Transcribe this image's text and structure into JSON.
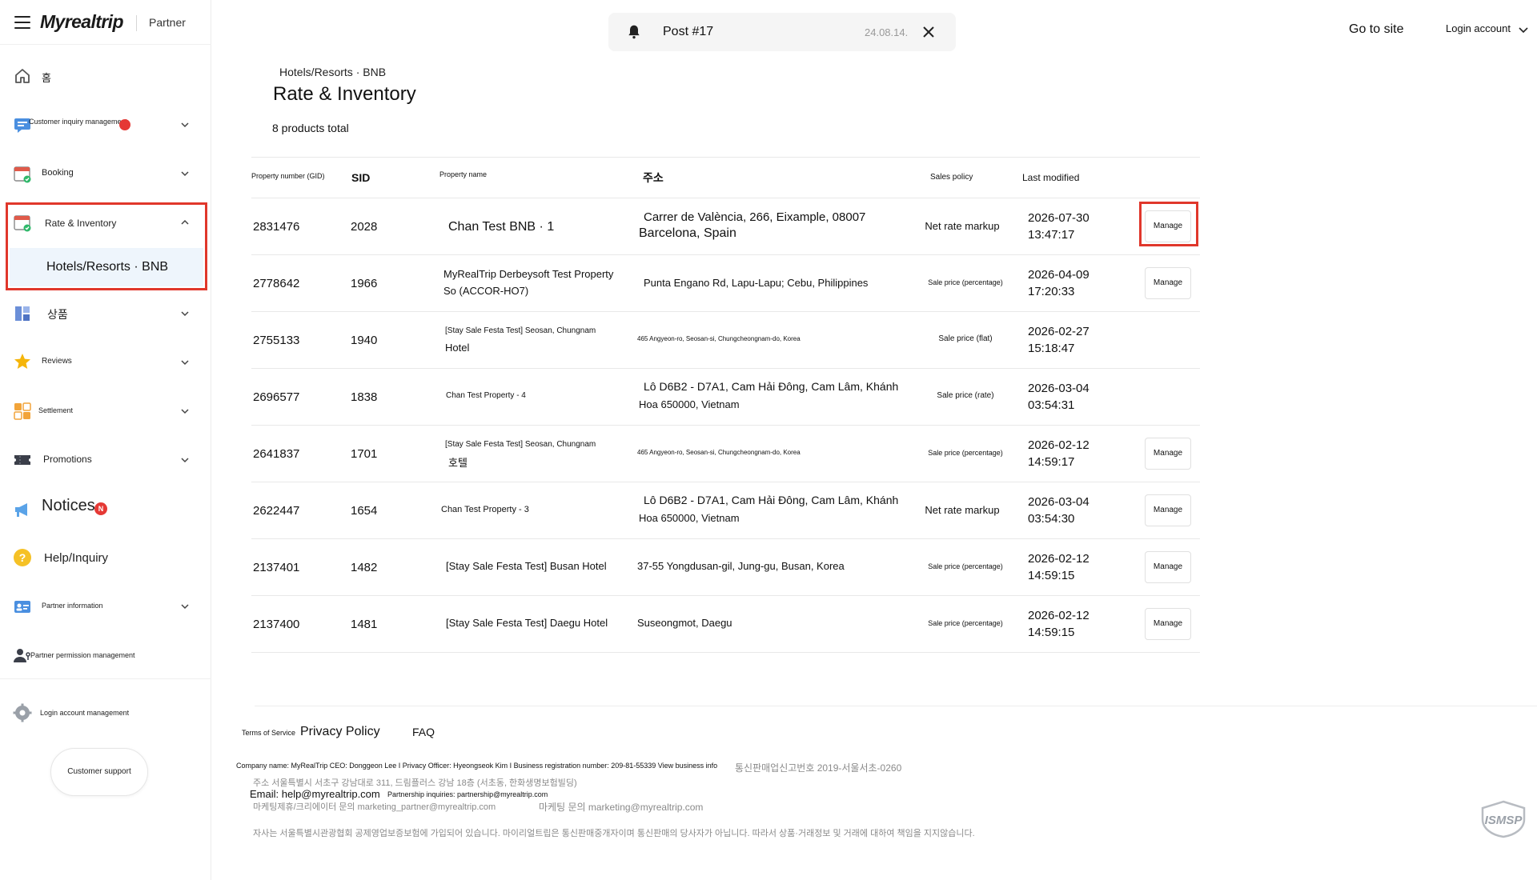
{
  "brand": {
    "logo_text": "Myrealtrip",
    "partner_label": "Partner"
  },
  "sidebar": {
    "home": "홈",
    "customer_inquiry": "Customer inquiry management",
    "booking": "Booking",
    "rate_inventory": "Rate & Inventory",
    "hotels_sub": "Hotels/Resorts · BNB",
    "products": "상품",
    "reviews": "Reviews",
    "settlement": "Settlement",
    "promotions": "Promotions",
    "notices": "Notices",
    "notices_badge": "N",
    "help": "Help/Inquiry",
    "partner_info": "Partner information",
    "permission": "Partner permission management",
    "login_mgmt": "Login account management",
    "customer_support": "Customer support"
  },
  "topbar": {
    "notice_title": "Post #17",
    "notice_date": "24.08.14.",
    "go_to_site": "Go to site",
    "login_account": "Login account"
  },
  "main": {
    "breadcrumb": "Hotels/Resorts · BNB",
    "title": "Rate & Inventory",
    "total": "8 products total"
  },
  "table": {
    "headers": {
      "property_number": "Property number (GID)",
      "sid": "SID",
      "property_name": "Property name",
      "address": "주소",
      "sales_policy": "Sales policy",
      "last_modified": "Last modified"
    },
    "manage_label": "Manage",
    "rows": [
      {
        "gid": "2831476",
        "sid": "2028",
        "name": "Chan Test BNB  · 1",
        "address_l1": "Carrer de València, 266, Eixample, 08007",
        "address_l2": "Barcelona, Spain",
        "policy": "Net rate markup",
        "date": "2026-07-30",
        "time": "13:47:17",
        "manage": true
      },
      {
        "gid": "2778642",
        "sid": "1966",
        "name": "MyRealTrip Derbeysoft Test Property So (ACCOR-HO7)",
        "address_l1": "Punta Engano Rd, Lapu-Lapu; Cebu, Philippines",
        "address_l2": "",
        "policy": "Sale price (percentage)",
        "date": "2026-04-09",
        "time": "17:20:33",
        "manage": true
      },
      {
        "gid": "2755133",
        "sid": "1940",
        "name_l1": "[Stay Sale Festa Test] Seosan, Chungnam",
        "name_l2": "Hotel",
        "address_l1": "465 Angyeon-ro, Seosan-si, Chungcheongnam-do, Korea",
        "address_l2": "",
        "policy": "Sale price (flat)",
        "date": "2026-02-27",
        "time": "15:18:47",
        "manage": false
      },
      {
        "gid": "2696577",
        "sid": "1838",
        "name": "Chan Test Property - 4",
        "address_l1": "Lô D6B2 - D7A1, Cam Hải Đông, Cam Lâm, Khánh",
        "address_l2": "Hoa 650000, Vietnam",
        "policy": "Sale price (rate)",
        "date": "2026-03-04",
        "time": "03:54:31",
        "manage": false
      },
      {
        "gid": "2641837",
        "sid": "1701",
        "name_l1": "[Stay Sale Festa Test] Seosan, Chungnam",
        "name_l2": "호텔",
        "address_l1": "465 Angyeon-ro, Seosan-si, Chungcheongnam-do, Korea",
        "address_l2": "",
        "policy": "Sale price (percentage)",
        "date": "2026-02-12",
        "time": "14:59:17",
        "manage": true
      },
      {
        "gid": "2622447",
        "sid": "1654",
        "name": "Chan Test Property - 3",
        "address_l1": "Lô D6B2 - D7A1, Cam Hải Đông, Cam Lâm, Khánh",
        "address_l2": "Hoa 650000, Vietnam",
        "policy": "Net rate markup",
        "date": "2026-03-04",
        "time": "03:54:30",
        "manage": true
      },
      {
        "gid": "2137401",
        "sid": "1482",
        "name": "[Stay Sale Festa Test] Busan Hotel",
        "address_l1": "37-55 Yongdusan-gil, Jung-gu, Busan, Korea",
        "address_l2": "",
        "policy": "Sale price (percentage)",
        "date": "2026-02-12",
        "time": "14:59:15",
        "manage": true
      },
      {
        "gid": "2137400",
        "sid": "1481",
        "name": "[Stay Sale Festa Test] Daegu Hotel",
        "address_l1": "Suseongmot, Daegu",
        "address_l2": "",
        "policy": "Sale price (percentage)",
        "date": "2026-02-12",
        "time": "14:59:15",
        "manage": true
      }
    ]
  },
  "footer": {
    "terms": "Terms of Service",
    "privacy": "Privacy Policy",
    "faq": "FAQ",
    "company": "Company name: MyRealTrip CEO: Donggeon Lee I Privacy Officer: Hyeongseok Kim I Business registration number: 209-81-55339 View business info",
    "mail_order": "통신판매업신고번호 2019-서울서초-0260",
    "address_kr": "주소 서울특별시 서초구 강남대로 311, 드림플러스 강남 18층 (서초동, 한화생명보험빌딩)",
    "email": "Email: help@myrealtrip.com",
    "partnership": "Partnership inquiries: partnership@myrealtrip.com",
    "marketing_partner": "마케팅제휴/크리에이터 문의 marketing_partner@myrealtrip.com",
    "marketing": "마케팅 문의 marketing@myrealtrip.com",
    "disclaimer": "자사는 서울특별시관광협회 공제영업보증보험에 가입되어 있습니다. 마이리얼트립은 통신판매중개자이며 통신판매의 당사자가 아닙니다. 따라서 상품·거래정보 및 거래에 대하여 책임을 지지않습니다.",
    "ismsp": "ISMSP"
  },
  "colors": {
    "highlight": "#e0372b",
    "sub_bg": "#eef5fc",
    "badge": "#e53935"
  }
}
